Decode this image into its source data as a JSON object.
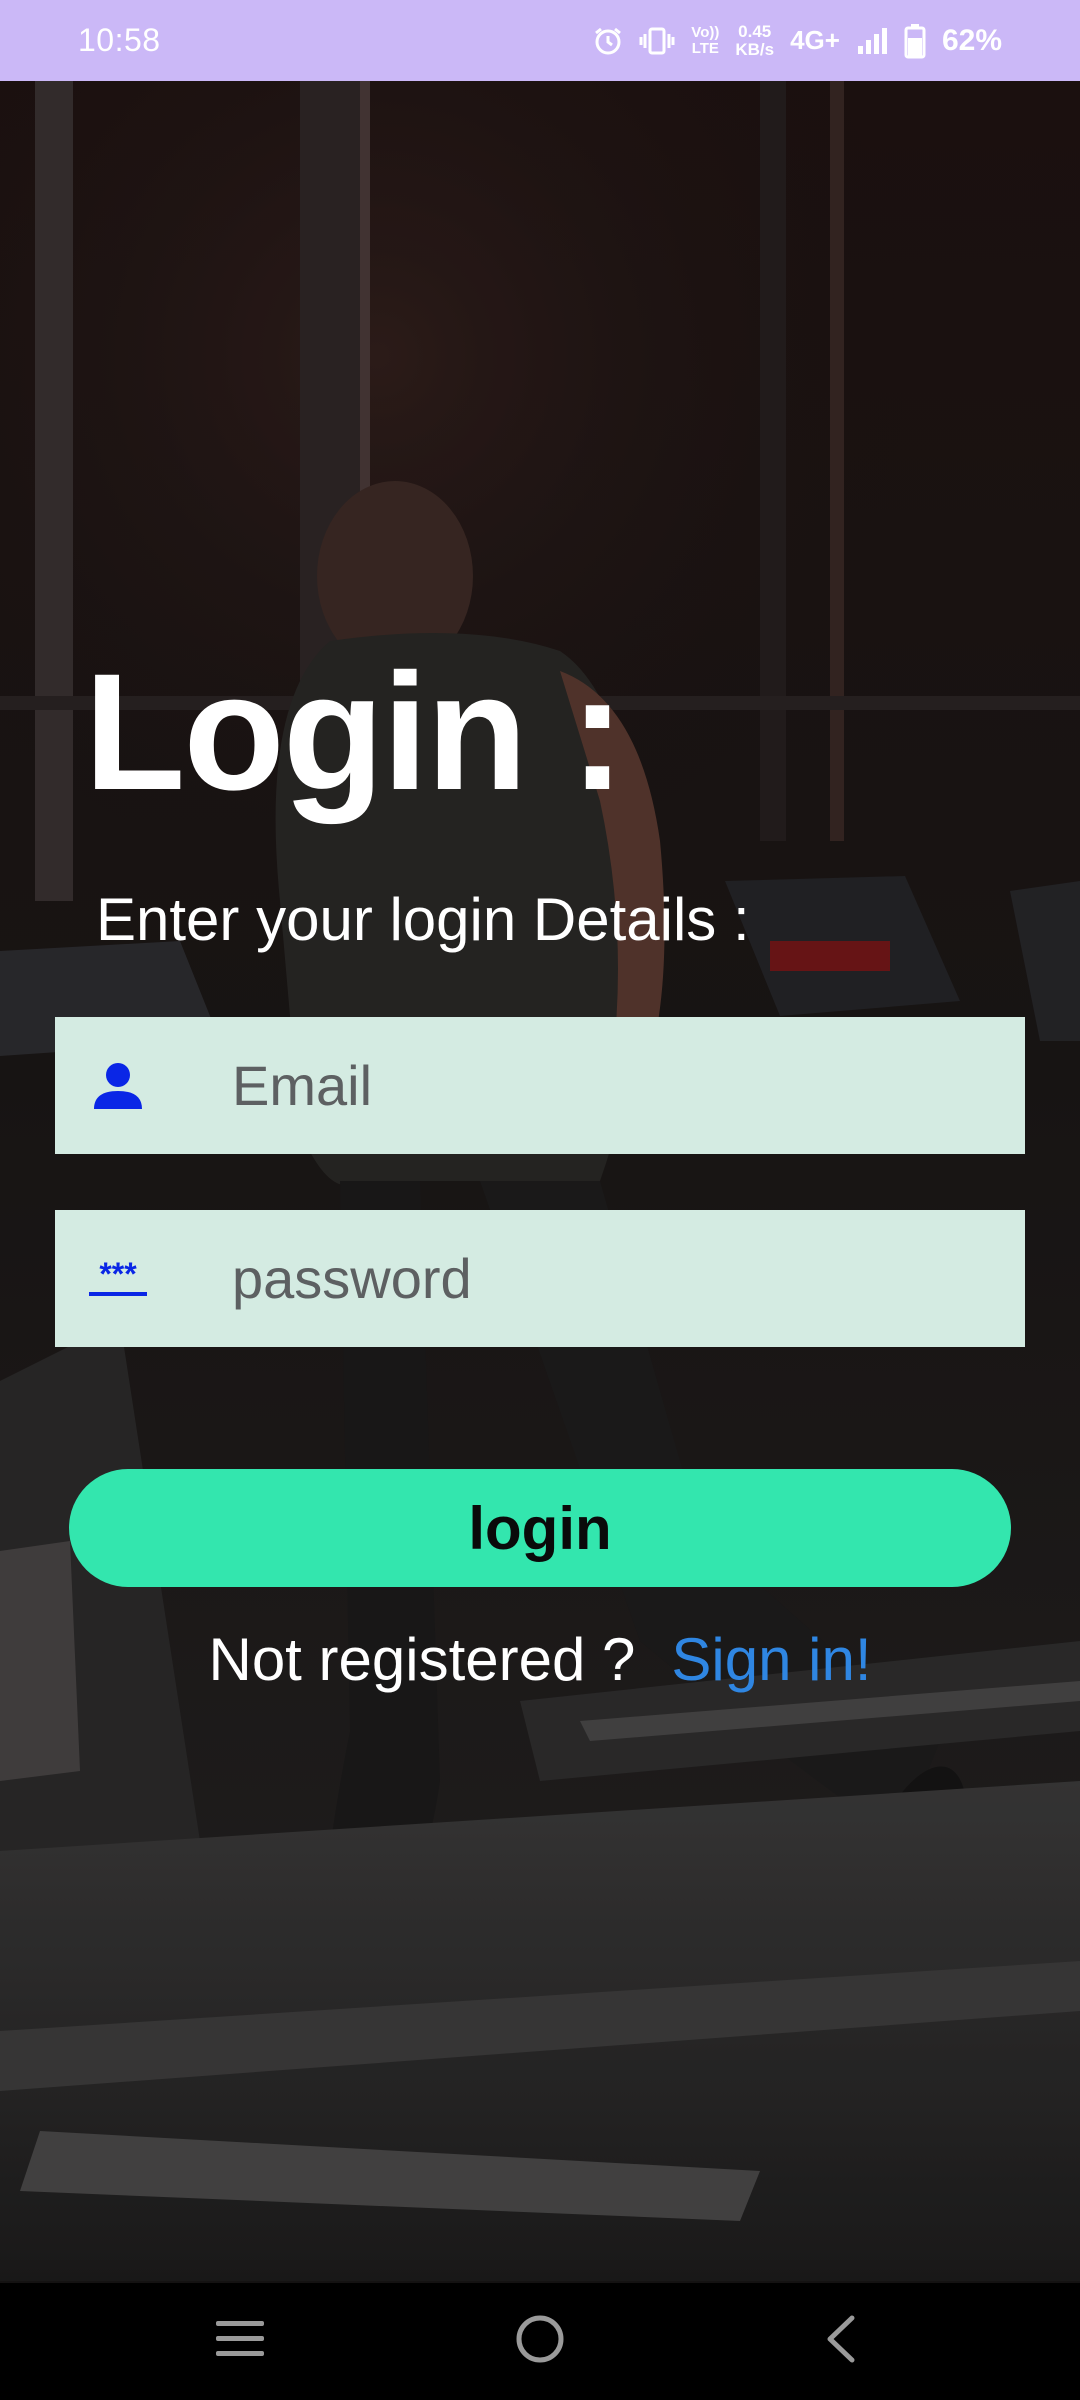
{
  "status_bar": {
    "time": "10:58",
    "network_speed_value": "0.45",
    "network_speed_unit": "KB/s",
    "volte_top": "Vo))",
    "volte_bottom": "LTE",
    "network_type": "4G+",
    "battery_percent": "62%",
    "icons": [
      "alarm-icon",
      "vibrate-icon",
      "volte-icon",
      "signal-icon",
      "battery-icon"
    ]
  },
  "login": {
    "title": "Login :",
    "subtitle": "Enter your login Details :",
    "email_placeholder": "Email",
    "email_icon": "person-icon",
    "password_placeholder": "password",
    "password_icon": "password-icon",
    "password_icon_glyph": "***",
    "button_label": "login",
    "register_prompt": "Not registered ?",
    "signin_link": "Sign in!"
  },
  "nav_bar": {
    "icons": [
      "menu-icon",
      "home-icon",
      "back-icon"
    ]
  },
  "colors": {
    "status_bar_bg": "#cbb8f7",
    "input_bg": "#d4ebe2",
    "icon_blue": "#0a26e6",
    "button_bg": "#33e6ae",
    "link_color": "#2f86e2",
    "nav_bg": "#000000"
  }
}
